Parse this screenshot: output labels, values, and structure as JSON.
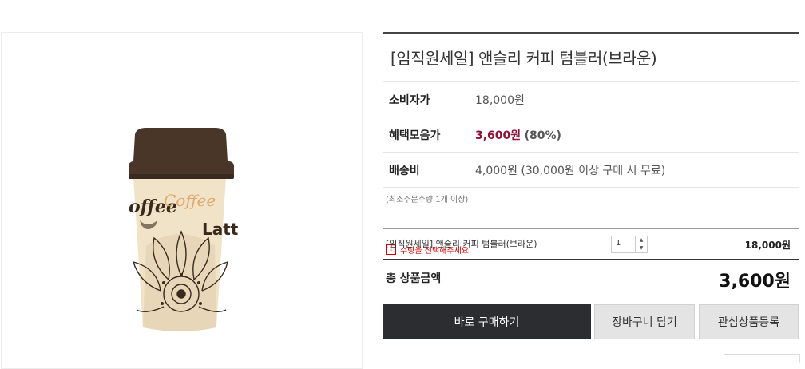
{
  "product": {
    "title": "[임직원세일] 앤슬리 커피 텀블러(브라운)",
    "image_alt": "coffee tumbler",
    "image_text": [
      "offee",
      "Coffee",
      "Latt"
    ]
  },
  "price_table": {
    "retail_label": "소비자가",
    "retail_value": "18,000원",
    "sale_label": "혜택모음가",
    "sale_value": "3,600원",
    "sale_rate": "(80%)",
    "shipping_label": "배송비",
    "shipping_value": "4,000원 (30,000원 이상 구매 시 무료)"
  },
  "notes": {
    "min_order": "(최소주문수량 1개 이상)",
    "warning": "수량을 선택해주세요."
  },
  "option": {
    "name": "[임직원세일] 앤슬리 커피 텀블러(브라운)",
    "quantity": "1",
    "price": "18,000원"
  },
  "total": {
    "label": "총 상품금액",
    "value": "3,600원"
  },
  "buttons": {
    "buy": "바로 구매하기",
    "cart": "장바구니 담기",
    "wish": "관심상품등록"
  },
  "colors": {
    "sale": "#8b1538",
    "buy_button": "#2b2d30",
    "secondary_button": "#e4e4e4"
  }
}
